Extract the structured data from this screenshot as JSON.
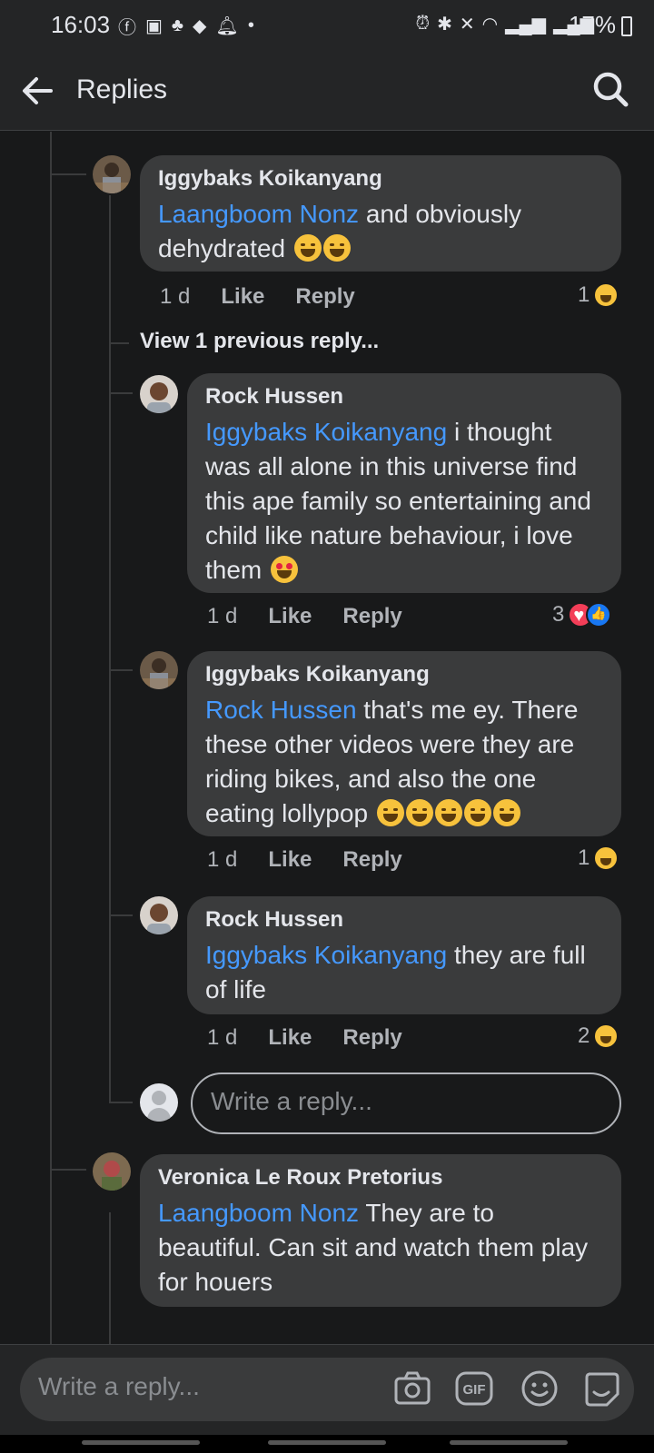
{
  "status_bar": {
    "time": "16:03",
    "battery": "17%"
  },
  "header": {
    "title": "Replies"
  },
  "comments": [
    {
      "author": "Iggybaks Koikanyang",
      "mention": "Laangboom Nonz",
      "text": " and obviously dehydrated ",
      "time": "1 d",
      "like": "Like",
      "reply": "Reply",
      "reaction_count": "1"
    },
    {
      "author": "Rock Hussen",
      "mention": "Iggybaks Koikanyang",
      "text": "  i thought was all alone in this universe find this ape family so entertaining and child like nature behaviour, i love them ",
      "time": "1 d",
      "like": "Like",
      "reply": "Reply",
      "reaction_count": "3"
    },
    {
      "author": "Iggybaks Koikanyang",
      "mention": "Rock Hussen",
      "text": " that's me ey. There these other videos were they are riding bikes, and also the one eating lollypop ",
      "time": "1 d",
      "like": "Like",
      "reply": "Reply",
      "reaction_count": "1"
    },
    {
      "author": "Rock Hussen",
      "mention": "Iggybaks Koikanyang",
      "text": "  they are full of life",
      "time": "1 d",
      "like": "Like",
      "reply": "Reply",
      "reaction_count": "2"
    },
    {
      "author": "Veronica Le Roux Pretorius",
      "mention": "Laangboom Nonz",
      "text": "  They are to beautiful.  Can sit and watch them play for houers"
    }
  ],
  "view_previous": "View 1 previous reply...",
  "inline_reply_placeholder": "Write a reply...",
  "bottom": {
    "placeholder": "Write a reply...",
    "icons": [
      "camera-icon",
      "gif-icon",
      "emoji-icon",
      "sticker-icon"
    ]
  },
  "colors": {
    "background": "#18191a",
    "bubble": "#3a3b3c",
    "mention": "#4599ff",
    "meta": "#b0b3b8"
  }
}
